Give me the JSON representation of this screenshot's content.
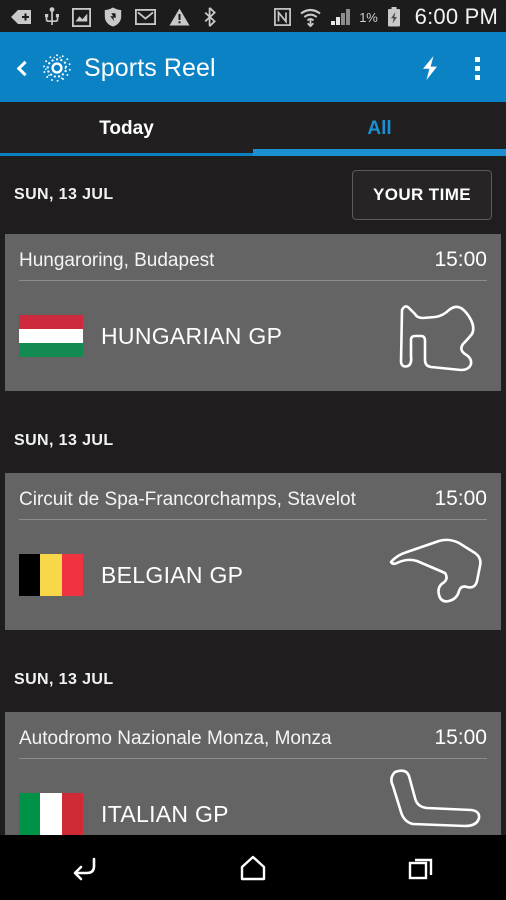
{
  "status_bar": {
    "battery_percent": "1%",
    "clock": "6:00 PM",
    "icons_left": [
      "back-arrow-plus-icon",
      "usb-icon",
      "screenshot-icon",
      "security-shield-icon",
      "gmail-icon",
      "warning-icon",
      "bluetooth-icon"
    ],
    "icons_right": [
      "nfc-icon",
      "wifi-icon",
      "signal-icon",
      "battery-charging-icon"
    ]
  },
  "app_bar": {
    "title": "Sports Reel",
    "back_icon": "back-chevron-icon",
    "logo_icon": "sports-reel-logo-icon",
    "action_icon": "lightning-bolt-icon",
    "overflow_icon": "overflow-menu-icon",
    "background_color": "#0b82c3"
  },
  "tabs": [
    {
      "label": "Today",
      "active": false
    },
    {
      "label": "All",
      "active": true
    }
  ],
  "toolbar": {
    "your_time_label": "YOUR TIME"
  },
  "colors": {
    "accent": "#0b82c3",
    "accent_light": "#1b8fd0",
    "card_bg": "#646464",
    "page_bg": "#1f1d1e"
  },
  "groups": [
    {
      "date": "SUN, 13 JUL",
      "show_your_time": true,
      "race": {
        "circuit": "Hungaroring, Budapest",
        "time": "15:00",
        "name": "HUNGARIAN GP",
        "flag_orientation": "horizontal",
        "flag_colors": [
          "#cd2a3e",
          "#ffffff",
          "#128a52"
        ],
        "circuit_map": "hungaroring-track-icon"
      }
    },
    {
      "date": "SUN, 13 JUL",
      "show_your_time": false,
      "race": {
        "circuit": "Circuit de Spa-Francorchamps, Stavelot",
        "time": "15:00",
        "name": "BELGIAN GP",
        "flag_orientation": "vertical",
        "flag_colors": [
          "#000000",
          "#f8d849",
          "#ef3340"
        ],
        "circuit_map": "spa-francorchamps-track-icon"
      }
    },
    {
      "date": "SUN, 13 JUL",
      "show_your_time": false,
      "race": {
        "circuit": "Autodromo Nazionale Monza, Monza",
        "time": "15:00",
        "name": "ITALIAN GP",
        "flag_orientation": "vertical",
        "flag_colors": [
          "#009246",
          "#ffffff",
          "#ce2b37"
        ],
        "circuit_map": "monza-track-icon"
      }
    }
  ],
  "nav_bar": {
    "back_label": "back-icon",
    "home_label": "home-icon",
    "recents_label": "recents-icon"
  }
}
